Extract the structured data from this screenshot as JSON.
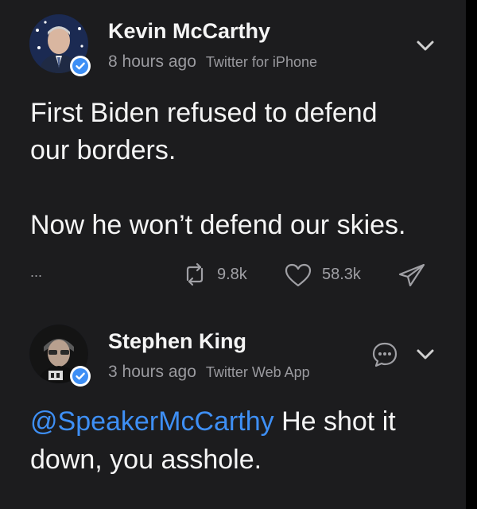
{
  "tweets": [
    {
      "author": "Kevin McCarthy",
      "time": "8 hours ago",
      "client": "Twitter for iPhone",
      "line1": "First Biden refused to defend",
      "line2": "our borders.",
      "line3": "Now he won’t defend our skies.",
      "more": "...",
      "retweets": "9.8k",
      "likes": "58.3k"
    },
    {
      "author": "Stephen King",
      "time": "3 hours ago",
      "client": "Twitter Web App",
      "mention": "@SpeakerMcCarthy",
      "rest": " He shot it",
      "line2": "down, you asshole."
    }
  ],
  "colors": {
    "background": "#000000",
    "card": "#1c1c1e",
    "mention": "#3e8ff5",
    "verified": "#3e8ff5",
    "muted": "#9a9a9f"
  },
  "icons": {
    "menu": "chevron-down-icon",
    "retweet": "retweet-icon",
    "like": "heart-icon",
    "share": "paper-plane-icon",
    "reply": "speech-bubble-icon",
    "badge": "verified-badge-icon"
  }
}
